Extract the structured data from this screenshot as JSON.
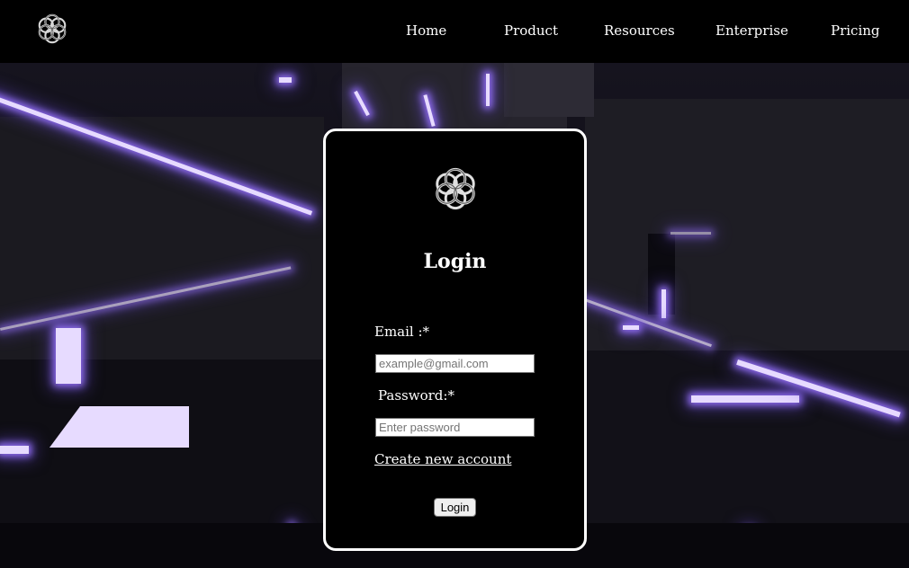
{
  "nav": {
    "items": [
      {
        "label": "Home"
      },
      {
        "label": "Product"
      },
      {
        "label": "Resources"
      },
      {
        "label": "Enterprise"
      },
      {
        "label": "Pricing"
      }
    ],
    "logo_icon": "celtic-knot-logo-icon"
  },
  "login": {
    "title": "Login",
    "email_label": "Email :*",
    "email_placeholder": "example@gmail.com",
    "email_value": "",
    "password_label": "Password:*",
    "password_placeholder": "Enter password",
    "password_value": "",
    "create_account_link": "Create new account",
    "submit_label": "Login",
    "logo_icon": "celtic-knot-logo-icon"
  },
  "colors": {
    "background": "#000000",
    "accent_glow": "#8f6cf0",
    "text": "#ffffff",
    "card_border": "#ffffff"
  }
}
